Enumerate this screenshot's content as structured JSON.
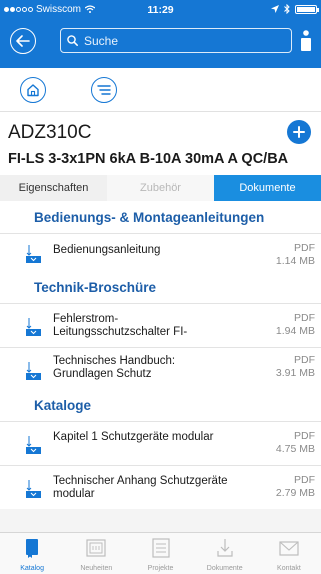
{
  "status_bar": {
    "carrier": "Swisscom",
    "time": "11:29"
  },
  "header": {
    "search_placeholder": "Suche"
  },
  "product": {
    "title": "ADZ310C",
    "subtitle": "FI-LS 3-3x1PN 6kA B-10A 30mA A QC/BA"
  },
  "tabs": [
    {
      "label": "Eigenschaften",
      "state": "normal"
    },
    {
      "label": "Zubehör",
      "state": "disabled"
    },
    {
      "label": "Dokumente",
      "state": "active"
    }
  ],
  "sections": [
    {
      "title": "Bedienungs- & Montageanleitungen",
      "documents": [
        {
          "name": "Bedienungsanleitung",
          "type": "PDF",
          "size": "1.14 MB"
        }
      ]
    },
    {
      "title": "Technik-Broschüre",
      "documents": [
        {
          "name": "Fehlerstrom-Leitungsschutzschalter FI-",
          "type": "PDF",
          "size": "1.94 MB"
        },
        {
          "name": "Technisches Handbuch: Grundlagen Schutz",
          "type": "PDF",
          "size": "3.91 MB"
        }
      ]
    },
    {
      "title": "Kataloge",
      "documents": [
        {
          "name": "Kapitel 1 Schutzgeräte modular",
          "type": "PDF",
          "size": "4.75 MB"
        },
        {
          "name": "Technischer Anhang Schutzgeräte modular",
          "type": "PDF",
          "size": "2.79 MB"
        }
      ]
    }
  ],
  "tabbar": [
    {
      "label": "Katalog",
      "icon": "book-icon",
      "active": true
    },
    {
      "label": "Neuheiten",
      "icon": "new-icon",
      "active": false
    },
    {
      "label": "Projekte",
      "icon": "list-icon",
      "active": false
    },
    {
      "label": "Dokumente",
      "icon": "download-icon",
      "active": false
    },
    {
      "label": "Kontakt",
      "icon": "mail-icon",
      "active": false
    }
  ],
  "colors": {
    "primary": "#1577d4",
    "active_tab": "#1a8ee0",
    "section_title": "#1d5ea8",
    "background": "#f4f4f4"
  }
}
